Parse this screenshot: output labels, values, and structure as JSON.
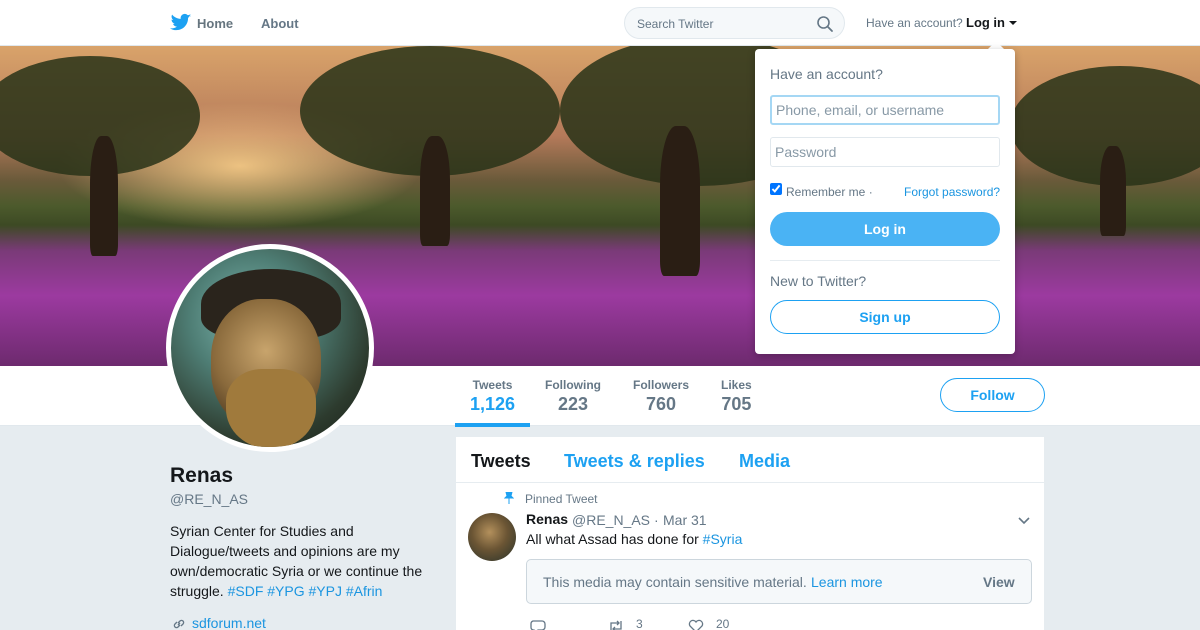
{
  "nav": {
    "home_label": "Home",
    "about_label": "About",
    "search_placeholder": "Search Twitter",
    "have_account_label": "Have an account?",
    "login_label": "Log in"
  },
  "profile": {
    "name": "Renas",
    "handle": "@RE_N_AS",
    "bio": "Syrian Center for Studies and Dialogue/tweets and opinions are my own/democratic Syria or we continue the struggle.",
    "bio_hashtags": "#SDF #YPG #YPJ #Afrin",
    "website": "sdforum.net",
    "follow_label": "Follow"
  },
  "stats": [
    {
      "label": "Tweets",
      "value": "1,126",
      "active": true
    },
    {
      "label": "Following",
      "value": "223",
      "active": false
    },
    {
      "label": "Followers",
      "value": "760",
      "active": false
    },
    {
      "label": "Likes",
      "value": "705",
      "active": false
    }
  ],
  "timeline": {
    "tabs": [
      "Tweets",
      "Tweets & replies",
      "Media"
    ],
    "pinned_label": "Pinned Tweet",
    "tweet": {
      "name": "Renas",
      "handle": "@RE_N_AS",
      "separator": "·",
      "date": "Mar 31",
      "text": "All what Assad has done for",
      "hashtag": "#Syria",
      "sensitive_text": "This media may contain sensitive material.",
      "learn_more": "Learn more",
      "view_label": "View",
      "retweets": "3",
      "likes": "20"
    }
  },
  "login_dropdown": {
    "title": "Have an account?",
    "username_placeholder": "Phone, email, or username",
    "password_placeholder": "Password",
    "remember_label": "Remember me ·",
    "forgot_label": "Forgot password?",
    "login_button": "Log in",
    "new_label": "New to Twitter?",
    "signup_button": "Sign up"
  },
  "colors": {
    "accent": "#1da1f2",
    "link": "#1b95e0",
    "muted": "#657786"
  }
}
